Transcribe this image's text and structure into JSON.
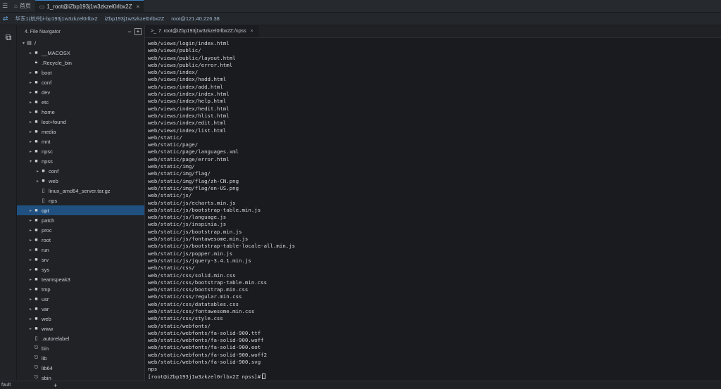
{
  "tabbar": {
    "menu_icon": "hamburger-icon",
    "tabs": [
      {
        "label": "首页",
        "icon": "home-icon",
        "active": false
      },
      {
        "label": "1_root@iZbp193j1w3zkzel0rlbx2Z",
        "icon": "terminal-icon",
        "active": true
      }
    ],
    "close_glyph": "×"
  },
  "session": {
    "items": [
      "华东1(杭州)i-bp193j1w3zkzel0rlbx2",
      "iZbp193j1w3zkzel0rlbx2Z",
      "root@121.40.226.38"
    ]
  },
  "vtool": {
    "icon": "file-copy-icon"
  },
  "file_navigator": {
    "title": "4. File Navigator",
    "collapse_icon": "−",
    "expand_icon": "+",
    "root": "/",
    "items": [
      {
        "name": "__MACOSX",
        "depth": 1,
        "type": "folder",
        "expanded": false
      },
      {
        "name": ".Recycle_bin",
        "depth": 1,
        "type": "locked-folder",
        "expanded": false
      },
      {
        "name": "boot",
        "depth": 1,
        "type": "folder",
        "expanded": false
      },
      {
        "name": "conf",
        "depth": 1,
        "type": "folder",
        "expanded": false
      },
      {
        "name": "dev",
        "depth": 1,
        "type": "folder",
        "expanded": false
      },
      {
        "name": "etc",
        "depth": 1,
        "type": "folder",
        "expanded": false
      },
      {
        "name": "home",
        "depth": 1,
        "type": "folder",
        "expanded": false
      },
      {
        "name": "lost+found",
        "depth": 1,
        "type": "folder",
        "expanded": false
      },
      {
        "name": "media",
        "depth": 1,
        "type": "folder",
        "expanded": false
      },
      {
        "name": "mnt",
        "depth": 1,
        "type": "folder",
        "expanded": false
      },
      {
        "name": "npsc",
        "depth": 1,
        "type": "folder",
        "expanded": false
      },
      {
        "name": "npss",
        "depth": 1,
        "type": "folder",
        "expanded": true
      },
      {
        "name": "conf",
        "depth": 2,
        "type": "folder",
        "expanded": false
      },
      {
        "name": "web",
        "depth": 2,
        "type": "folder",
        "expanded": false
      },
      {
        "name": "linux_amd64_server.tar.gz",
        "depth": 2,
        "type": "file"
      },
      {
        "name": "nps",
        "depth": 2,
        "type": "file"
      },
      {
        "name": "opt",
        "depth": 1,
        "type": "folder",
        "expanded": false,
        "selected": true
      },
      {
        "name": "patch",
        "depth": 1,
        "type": "folder",
        "expanded": false
      },
      {
        "name": "proc",
        "depth": 1,
        "type": "folder",
        "expanded": false
      },
      {
        "name": "root",
        "depth": 1,
        "type": "folder",
        "expanded": false
      },
      {
        "name": "run",
        "depth": 1,
        "type": "folder",
        "expanded": false
      },
      {
        "name": "srv",
        "depth": 1,
        "type": "folder",
        "expanded": false
      },
      {
        "name": "sys",
        "depth": 1,
        "type": "folder",
        "expanded": false
      },
      {
        "name": "teamspeak3",
        "depth": 1,
        "type": "folder",
        "expanded": false
      },
      {
        "name": "tmp",
        "depth": 1,
        "type": "folder",
        "expanded": false
      },
      {
        "name": "usr",
        "depth": 1,
        "type": "folder",
        "expanded": false
      },
      {
        "name": "var",
        "depth": 1,
        "type": "folder",
        "expanded": false
      },
      {
        "name": "web",
        "depth": 1,
        "type": "folder",
        "expanded": false
      },
      {
        "name": "www",
        "depth": 1,
        "type": "folder",
        "expanded": false
      },
      {
        "name": ".autorelabel",
        "depth": 1,
        "type": "file"
      },
      {
        "name": "bin",
        "depth": 1,
        "type": "link"
      },
      {
        "name": "lib",
        "depth": 1,
        "type": "link"
      },
      {
        "name": "lib64",
        "depth": 1,
        "type": "link"
      },
      {
        "name": "sbin",
        "depth": 1,
        "type": "link"
      }
    ]
  },
  "terminal": {
    "tab_label": "7. root@iZbp193j1w3zkzel0rlbx2Z:/npss",
    "tab_icon": "terminal-prompt-icon",
    "lines": [
      "web/views/login/index.html",
      "web/views/public/",
      "web/views/public/layout.html",
      "web/views/public/error.html",
      "web/views/index/",
      "web/views/index/hadd.html",
      "web/views/index/add.html",
      "web/views/index/index.html",
      "web/views/index/help.html",
      "web/views/index/hedit.html",
      "web/views/index/hlist.html",
      "web/views/index/edit.html",
      "web/views/index/list.html",
      "web/static/",
      "web/static/page/",
      "web/static/page/languages.xml",
      "web/static/page/error.html",
      "web/static/img/",
      "web/static/img/flag/",
      "web/static/img/flag/zh-CN.png",
      "web/static/img/flag/en-US.png",
      "web/static/js/",
      "web/static/js/echarts.min.js",
      "web/static/js/bootstrap-table.min.js",
      "web/static/js/language.js",
      "web/static/js/inspinia.js",
      "web/static/js/bootstrap.min.js",
      "web/static/js/fontawesome.min.js",
      "web/static/js/bootstrap-table-locale-all.min.js",
      "web/static/js/popper.min.js",
      "web/static/js/jquery-3.4.1.min.js",
      "web/static/css/",
      "web/static/css/solid.min.css",
      "web/static/css/bootstrap-table.min.css",
      "web/static/css/bootstrap.min.css",
      "web/static/css/regular.min.css",
      "web/static/css/datatables.css",
      "web/static/css/fontawesome.min.css",
      "web/static/css/style.css",
      "web/static/webfonts/",
      "web/static/webfonts/fa-solid-900.ttf",
      "web/static/webfonts/fa-solid-900.woff",
      "web/static/webfonts/fa-solid-900.eot",
      "web/static/webfonts/fa-solid-900.woff2",
      "web/static/webfonts/fa-solid-900.svg",
      "nps"
    ],
    "prompt": "[root@iZbp193j1w3zkzel0rlbx2Z npss]#"
  },
  "statusbar": {
    "left_label": "fault",
    "add_label": "+"
  },
  "colors": {
    "selection": "#1f5080",
    "accent": "#3b82c4",
    "terminal_bg": "#191b1e"
  }
}
